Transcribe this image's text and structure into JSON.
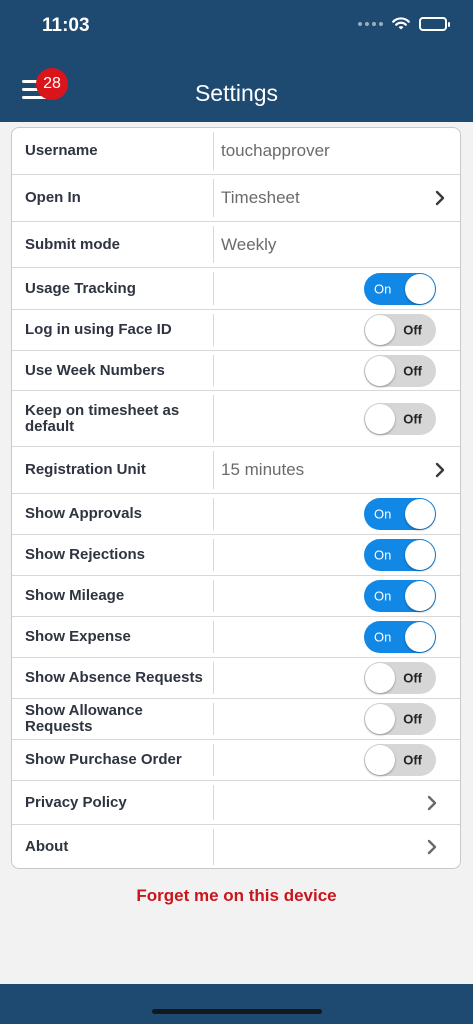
{
  "status": {
    "time": "11:03"
  },
  "header": {
    "title": "Settings",
    "badge_count": "28"
  },
  "rows": [
    {
      "label": "Username",
      "value": "touchapprover"
    },
    {
      "label": "Open In",
      "value": "Timesheet"
    },
    {
      "label": "Submit mode",
      "value": "Weekly"
    },
    {
      "label": "Usage Tracking",
      "toggle": "On"
    },
    {
      "label": "Log in using Face ID",
      "toggle": "Off"
    },
    {
      "label": "Use Week Numbers",
      "toggle": "Off"
    },
    {
      "label": "Keep on timesheet as default",
      "toggle": "Off"
    },
    {
      "label": "Registration Unit",
      "value": "15 minutes"
    },
    {
      "label": "Show Approvals",
      "toggle": "On"
    },
    {
      "label": "Show Rejections",
      "toggle": "On"
    },
    {
      "label": "Show Mileage",
      "toggle": "On"
    },
    {
      "label": "Show Expense",
      "toggle": "On"
    },
    {
      "label": "Show Absence Requests",
      "toggle": "Off"
    },
    {
      "label": "Show Allowance Requests",
      "toggle": "Off"
    },
    {
      "label": "Show Purchase Order",
      "toggle": "Off"
    },
    {
      "label": "Privacy Policy"
    },
    {
      "label": "About"
    }
  ],
  "footer": {
    "forget_label": "Forget me on this device"
  },
  "colors": {
    "header_bg": "#1e4a72",
    "toggle_on": "#1188e6",
    "toggle_off": "#d6d6d6",
    "badge": "#d9141b",
    "forget_text": "#c8161d"
  }
}
